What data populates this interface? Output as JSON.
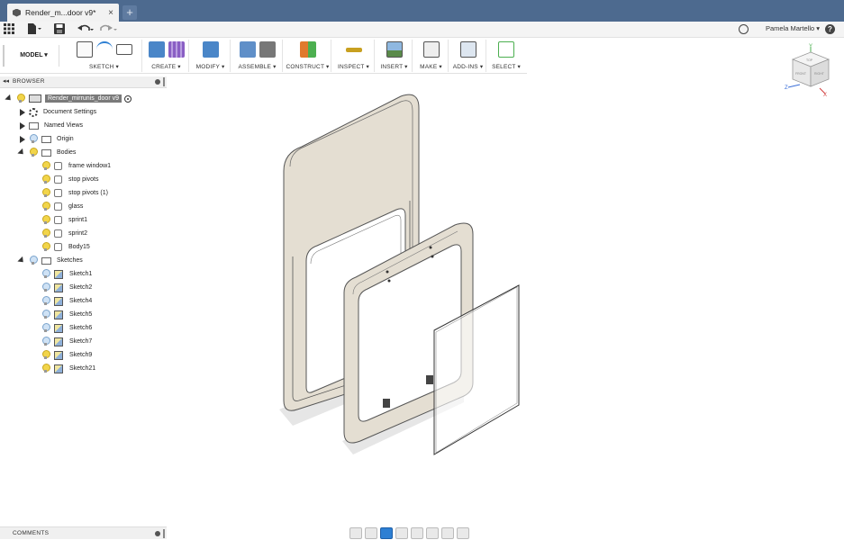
{
  "tab": {
    "title": "Render_m...door v9*",
    "close": "×",
    "new": "+"
  },
  "quick_access": {
    "user_name": "Pamela Martello ▾",
    "help": "?"
  },
  "toolbar": {
    "workspace": "MODEL ▾",
    "groups": [
      {
        "label": "SKETCH ▾"
      },
      {
        "label": "CREATE ▾"
      },
      {
        "label": "MODIFY ▾"
      },
      {
        "label": "ASSEMBLE ▾"
      },
      {
        "label": "CONSTRUCT ▾"
      },
      {
        "label": "INSPECT ▾"
      },
      {
        "label": "INSERT ▾"
      },
      {
        "label": "MAKE ▾"
      },
      {
        "label": "ADD-INS ▾"
      },
      {
        "label": "SELECT ▾"
      }
    ]
  },
  "viewcube": {
    "top": "TOP",
    "front": "FRONT",
    "right": "RIGHT",
    "x": "X",
    "y": "Y",
    "z": "Z"
  },
  "browser": {
    "title": "BROWSER",
    "root": "Render_mirrunis_door v9",
    "items": [
      {
        "label": "Document Settings"
      },
      {
        "label": "Named Views"
      },
      {
        "label": "Origin"
      },
      {
        "label": "Bodies"
      },
      {
        "label": "frame window1"
      },
      {
        "label": "stop pivots"
      },
      {
        "label": "stop pivots (1)"
      },
      {
        "label": "glass"
      },
      {
        "label": "sprint1"
      },
      {
        "label": "sprint2"
      },
      {
        "label": "Body15"
      },
      {
        "label": "Sketches"
      },
      {
        "label": "Sketch1"
      },
      {
        "label": "Sketch2"
      },
      {
        "label": "Sketch4"
      },
      {
        "label": "Sketch5"
      },
      {
        "label": "Sketch6"
      },
      {
        "label": "Sketch7"
      },
      {
        "label": "Sketch9"
      },
      {
        "label": "Sketch21"
      }
    ]
  },
  "comments": {
    "title": "COMMENTS"
  },
  "colors": {
    "tabbar": "#4d6a8f",
    "accent": "#2d7fd3",
    "frame_fill": "#e2dcd0",
    "bulb": "#f2d54a"
  }
}
